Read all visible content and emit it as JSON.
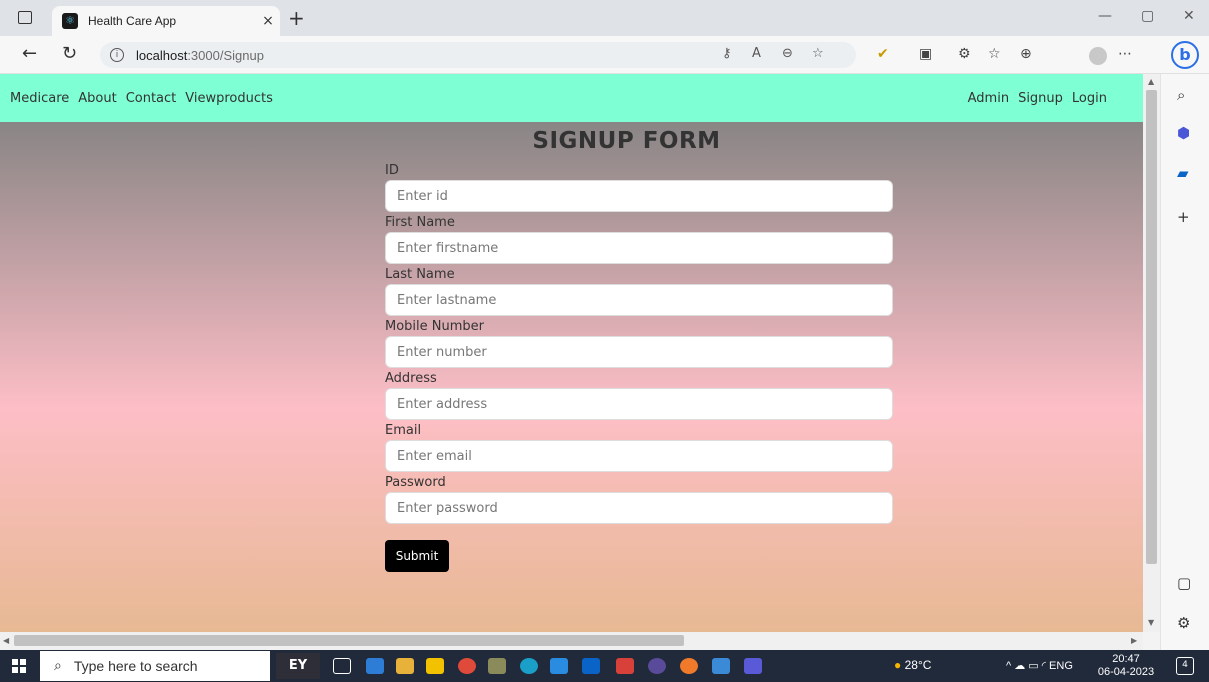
{
  "browser": {
    "tab_title": "Health Care App",
    "tab_close": "×",
    "new_tab": "+",
    "url_host": "localhost",
    "url_path": ":3000/Signup",
    "window_controls": [
      "—",
      "▢",
      "✕"
    ]
  },
  "app_nav": {
    "left_links": [
      "Medicare",
      "About",
      "Contact",
      "Viewproducts"
    ],
    "right_links": [
      "Admin",
      "Signup",
      "Login"
    ]
  },
  "form": {
    "title": "SIGNUP FORM",
    "fields": [
      {
        "label": "ID",
        "placeholder": "Enter id"
      },
      {
        "label": "First Name",
        "placeholder": "Enter firstname"
      },
      {
        "label": "Last Name",
        "placeholder": "Enter lastname"
      },
      {
        "label": "Mobile Number",
        "placeholder": "Enter number"
      },
      {
        "label": "Address",
        "placeholder": "Enter address"
      },
      {
        "label": "Email",
        "placeholder": "Enter email"
      },
      {
        "label": "Password",
        "placeholder": "Enter password"
      }
    ],
    "submit_label": "Submit"
  },
  "taskbar": {
    "search_placeholder": "Type here to search",
    "ey_label": "EY",
    "weather": "28°C",
    "language": "ENG",
    "time": "20:47",
    "date": "06-04-2023",
    "notification_count": "4"
  },
  "colors": {
    "nav_bg": "#7fffd4",
    "gradient_top": "#898585",
    "gradient_mid": "#fdbec6",
    "gradient_bottom": "#e7b993",
    "submit_bg": "#000000"
  }
}
